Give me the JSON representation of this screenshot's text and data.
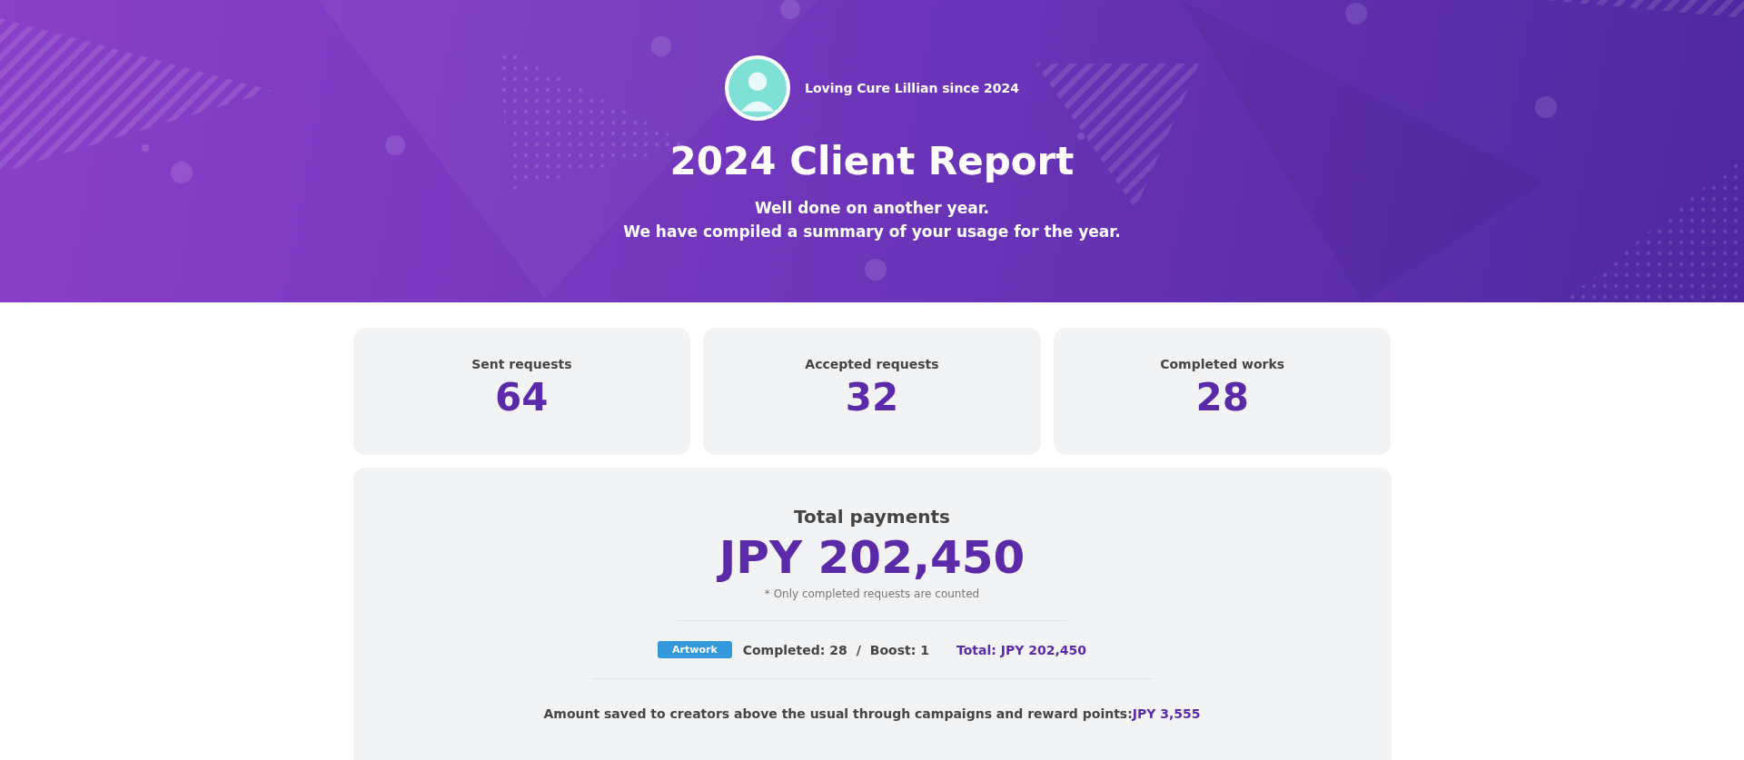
{
  "header": {
    "tagline": "Loving Cure Lillian since 2024",
    "title": "2024 Client Report",
    "subtitle_lines": [
      "Well done on another year.",
      "We have compiled a summary of your usage for the year."
    ]
  },
  "stats": [
    {
      "label": "Sent requests",
      "value": "64"
    },
    {
      "label": "Accepted requests",
      "value": "32"
    },
    {
      "label": "Completed works",
      "value": "28"
    }
  ],
  "payments": {
    "title": "Total payments",
    "amount": "JPY 202,450",
    "note": "* Only completed requests are counted",
    "breakdown": [
      {
        "category": "Artwork",
        "completed": "Completed: 28",
        "separator": "/",
        "boost": "Boost: 1",
        "total": "Total: JPY 202,450"
      }
    ],
    "savings_label": "Amount saved to creators above the usual through campaigns and reward points:",
    "savings_amount": "JPY 3,555"
  }
}
